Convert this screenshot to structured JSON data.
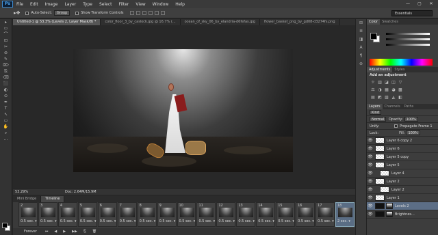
{
  "app": {
    "logo": "Ps"
  },
  "menu": [
    "File",
    "Edit",
    "Image",
    "Layer",
    "Type",
    "Select",
    "Filter",
    "View",
    "Window",
    "Help"
  ],
  "window_controls": [
    "—",
    "▢",
    "✕"
  ],
  "options_bar": {
    "tool_icon": "move-tool-icon",
    "tool_glyph": "▸✥",
    "auto_select_label": "Auto-Select:",
    "auto_select_value": "Group",
    "transform_label": "Show Transform Controls",
    "workspace": "Essentials"
  },
  "tools": [
    "▸",
    "▭",
    "⌒",
    "⊡",
    "✂",
    "⊘",
    "✎",
    "⌦",
    "⎘",
    "⌫",
    "⬛",
    "◐",
    "⊙",
    "✒",
    "T",
    "↖",
    "▭",
    "✋",
    "⌕",
    "…"
  ],
  "doc_tabs": [
    "Untitled-1 @ 53.3% (Levels 2, Layer Mask/8) *",
    "color_floor_3_by_caslock.jpg @ 16.7% (...",
    "ocean_of_sky_06_by_elandria-d6fefas.jpg",
    "flower_basket_png_by_gd08-d3274fs.png"
  ],
  "status": {
    "zoom": "53.29%",
    "doc": "Doc: 2.64M/15.9M"
  },
  "bottom_tabs": [
    "Mini Bridge",
    "Timeline"
  ],
  "frames": [
    {
      "num": "2",
      "delay": "0.5 sec."
    },
    {
      "num": "3",
      "delay": "0.5 sec."
    },
    {
      "num": "4",
      "delay": "0.5 sec."
    },
    {
      "num": "5",
      "delay": "0.5 sec."
    },
    {
      "num": "6",
      "delay": "0.5 sec."
    },
    {
      "num": "7",
      "delay": "0.5 sec."
    },
    {
      "num": "8",
      "delay": "0.5 sec."
    },
    {
      "num": "9",
      "delay": "0.5 sec."
    },
    {
      "num": "10",
      "delay": "0.5 sec."
    },
    {
      "num": "11",
      "delay": "0.5 sec."
    },
    {
      "num": "12",
      "delay": "0.5 sec."
    },
    {
      "num": "13",
      "delay": "0.5 sec."
    },
    {
      "num": "14",
      "delay": "0.5 sec."
    },
    {
      "num": "15",
      "delay": "0.5 sec."
    },
    {
      "num": "16",
      "delay": "0.5 sec."
    },
    {
      "num": "17",
      "delay": "0.5 sec."
    },
    {
      "num": "18",
      "delay": "2 sec."
    }
  ],
  "timeline_ctrl": {
    "loop": "Forever",
    "buttons": [
      "⏮",
      "◀",
      "▶",
      "▶▶",
      "⎘",
      "🗑"
    ]
  },
  "dock_icons": [
    "⊞",
    "≣",
    "◨",
    "A",
    "¶",
    "⊛"
  ],
  "panels": {
    "color_tabs": [
      "Color",
      "Swatches"
    ],
    "adj_tabs": [
      "Adjustments",
      "Styles"
    ],
    "adj_title": "Add an adjustment",
    "adj_rows": [
      [
        "☼",
        "▥",
        "◪",
        "◫",
        "▽"
      ],
      [
        "⚖",
        "◑",
        "▦",
        "◕",
        "▩"
      ],
      [
        "▤",
        "◩",
        "▧",
        "◭",
        "◧"
      ]
    ],
    "layers_tabs": [
      "Layers",
      "Channels",
      "Paths"
    ],
    "kind_label": "Kind",
    "blend": "Normal",
    "opacity_label": "Opacity:",
    "opacity": "100%",
    "unify_label": "Unify:",
    "propagate": "Propagate Frame 1",
    "lock_label": "Lock:",
    "fill_label": "Fill:",
    "fill": "100%",
    "layers": [
      {
        "name": "Layer 6 copy 2",
        "visible": true
      },
      {
        "name": "Layer 6",
        "visible": true
      },
      {
        "name": "Layer 5 copy",
        "visible": true
      },
      {
        "name": "Layer 5",
        "visible": true
      },
      {
        "name": "Layer 4",
        "visible": true,
        "indent": true
      },
      {
        "name": "Layer 2",
        "visible": true
      },
      {
        "name": "Layer 2",
        "visible": true,
        "indent": true
      },
      {
        "name": "Layer 1",
        "visible": true
      },
      {
        "name": "Levels 2",
        "visible": true,
        "selected": true,
        "adjust": true
      },
      {
        "name": "Brightnes...",
        "visible": true,
        "adjust": true
      }
    ]
  }
}
